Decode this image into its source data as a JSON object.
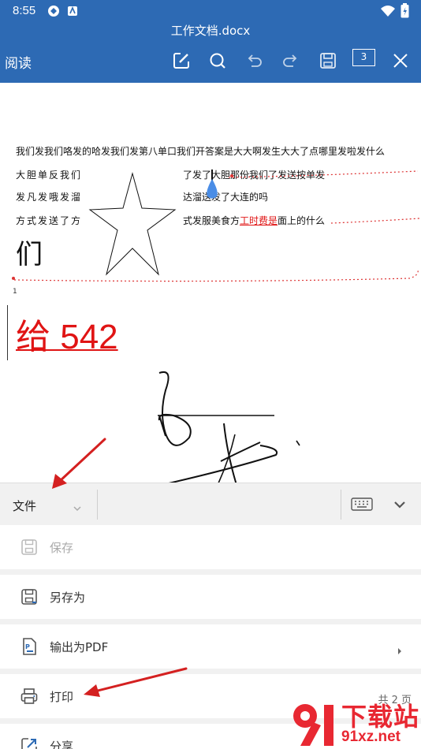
{
  "status": {
    "time": "8:55"
  },
  "header": {
    "doc_title": "工作文档.docx",
    "mode_label": "阅读",
    "page_count": "3"
  },
  "document": {
    "lines": [
      "我们发我们咯发的哈发我们发第八单口我们开答案是大大啊发生大大了点哪里发啦发什么",
      "大胆单反我们",
      "了发了大胆那份我们了发送按单发",
      "发凡发哦发溜",
      "达溜送发了大连的吗",
      "方式发送了方",
      "式发服美食方",
      "工时费是",
      "面上的什么"
    ],
    "large_char": "们",
    "line_marker": "1",
    "red_heading": "给 542"
  },
  "menu": {
    "file_label": "文件",
    "items": [
      {
        "label": "保存",
        "icon": "save-icon",
        "enabled": false
      },
      {
        "label": "另存为",
        "icon": "save-as-icon",
        "enabled": true
      },
      {
        "label": "输出为PDF",
        "icon": "pdf-export-icon",
        "enabled": true
      },
      {
        "label": "打印",
        "icon": "print-icon",
        "enabled": true
      },
      {
        "label": "分享",
        "icon": "share-icon",
        "enabled": true
      }
    ],
    "print_pages": "共 2 页"
  },
  "watermark": {
    "brand": "下载站",
    "domain": "91xz.net"
  },
  "colors": {
    "toolbar": "#2d6ab4",
    "accent_red": "#e01414",
    "menu_bg": "#f1f1f1",
    "arrow": "#d42020"
  }
}
